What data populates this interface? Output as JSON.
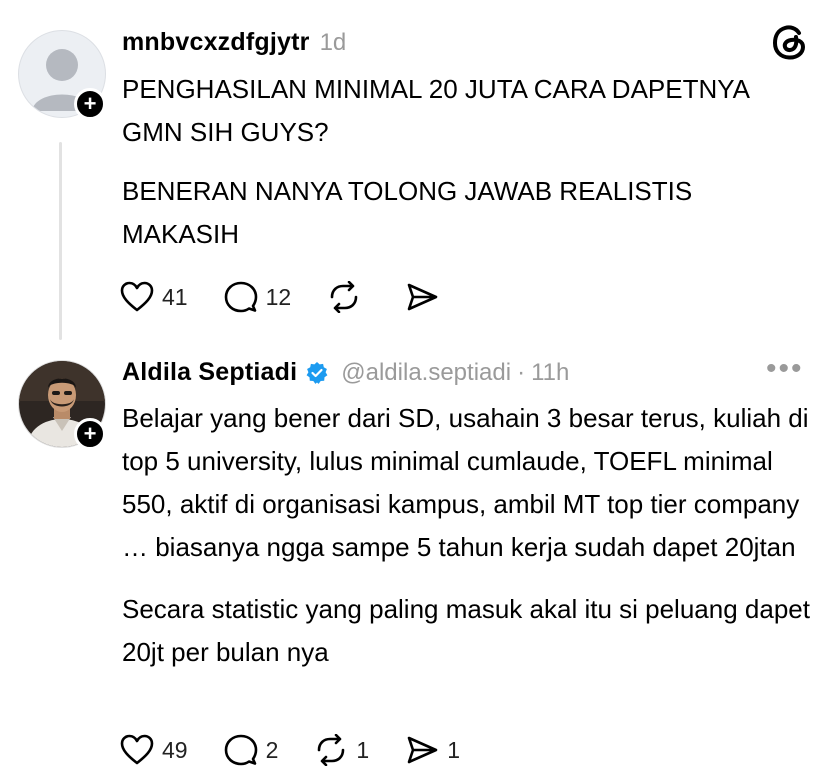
{
  "post1": {
    "username": "mnbvcxzdfgjytr",
    "time": "1d",
    "paragraphs": [
      "PENGHASILAN MINIMAL 20 JUTA CARA DAPETNYA GMN SIH GUYS?",
      "BENERAN NANYA TOLONG JAWAB REALISTIS MAKASIH"
    ],
    "likes": "41",
    "replies": "12",
    "reposts": "",
    "shares": ""
  },
  "post2": {
    "display_name": "Aldila Septiadi",
    "handle": "@aldila.septiadi",
    "separator": "·",
    "time": "11h",
    "paragraphs": [
      "Belajar yang bener dari SD, usahain 3 besar terus, kuliah di top 5 university, lulus minimal cumlaude, TOEFL minimal 550, aktif di organisasi kampus, ambil MT top tier company … biasanya ngga sampe 5 tahun kerja sudah dapet 20jtan",
      "Secara statistic yang paling masuk akal itu si peluang dapet 20jt per bulan nya"
    ],
    "likes": "49",
    "replies": "2",
    "reposts": "1",
    "shares": "1"
  },
  "icons": {
    "app_logo": "threads-logo-icon",
    "verified": "verified-badge-icon",
    "more": "more-options-icon",
    "follow": "plus-icon"
  },
  "colors": {
    "verified": "#1d9bf0",
    "meta": "#9a9a9a",
    "thread_line": "#e2e2e2"
  }
}
